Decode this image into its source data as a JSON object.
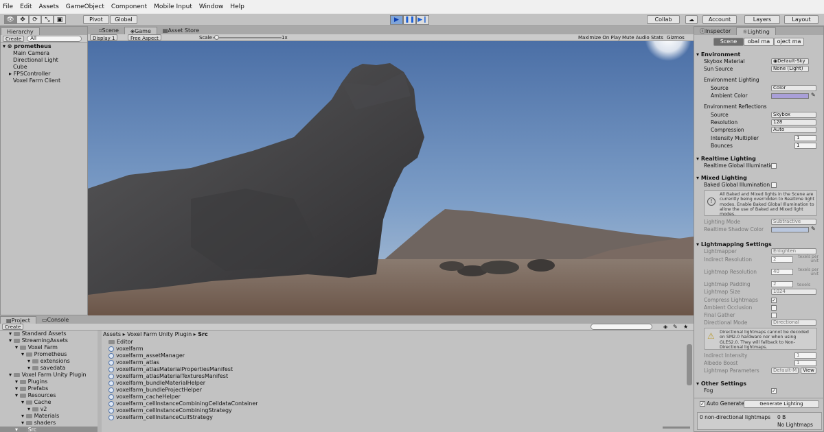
{
  "menu": [
    "File",
    "Edit",
    "Assets",
    "GameObject",
    "Component",
    "Mobile Input",
    "Window",
    "Help"
  ],
  "toolbar": {
    "pivot": "Pivot",
    "global": "Global",
    "collab": "Collab",
    "account": "Account",
    "layers": "Layers",
    "layout": "Layout"
  },
  "hierarchy": {
    "tab": "Hierarchy",
    "create": "Create",
    "search": "All",
    "scene": "prometheus",
    "items": [
      "Main Camera",
      "Directional Light",
      "Cube",
      "FPSController",
      "Voxel Farm Client"
    ]
  },
  "views": {
    "tabs": [
      "Scene",
      "Game",
      "Asset Store"
    ],
    "display": "Display 1",
    "aspect": "Free Aspect",
    "scale_label": "Scale",
    "scale_value": "1x",
    "buttons": [
      "Maximize On Play",
      "Mute Audio",
      "Stats",
      "Gizmos"
    ]
  },
  "inspector": {
    "tabs": [
      "Inspector",
      "Lighting"
    ],
    "seg": [
      "Scene",
      "obal ma",
      "oject ma"
    ],
    "environment": {
      "title": "Environment",
      "skybox_label": "Skybox Material",
      "skybox_val": "Default-Sky",
      "sun_label": "Sun Source",
      "sun_val": "None (Light)",
      "env_lighting": "Environment Lighting",
      "source_label": "Source",
      "source_val": "Color",
      "ambient_label": "Ambient Color",
      "ambient_color": "#a99fd8",
      "reflections": "Environment Reflections",
      "rsource_val": "Skybox",
      "resolution_label": "Resolution",
      "resolution_val": "128",
      "compression_label": "Compression",
      "compression_val": "Auto",
      "intensity_label": "Intensity Multiplier",
      "intensity_val": "1",
      "bounces_label": "Bounces",
      "bounces_val": "1"
    },
    "realtime": {
      "title": "Realtime Lighting",
      "gi_label": "Realtime Global Illuminatic"
    },
    "mixed": {
      "title": "Mixed Lighting",
      "baked_label": "Baked Global Illumination",
      "info": "All Baked and Mixed lights in the Scene are currently being overridden to Realtime light modes. Enable Baked Global Illumination to allow the use of Baked and Mixed light modes.",
      "mode_label": "Lighting Mode",
      "mode_val": "Subtractive",
      "shadow_label": "Realtime Shadow Color",
      "shadow_color": "#b9c6dd"
    },
    "lightmapping": {
      "title": "Lightmapping Settings",
      "lightmapper_label": "Lightmapper",
      "lightmapper_val": "Enlighten",
      "indirect_label": "Indirect Resolution",
      "indirect_val": "2",
      "indirect_unit": "texels per unit",
      "lmres_label": "Lightmap Resolution",
      "lmres_val": "40",
      "lmres_unit": "texels per unit",
      "padding_label": "Lightmap Padding",
      "padding_val": "2",
      "padding_unit": "texels",
      "size_label": "Lightmap Size",
      "size_val": "1024",
      "compress_label": "Compress Lightmaps",
      "ao_label": "Ambient Occlusion",
      "fg_label": "Final Gather",
      "dir_label": "Directional Mode",
      "dir_val": "Directional",
      "dir_info": "Directional lightmaps cannot be decoded on SM2.0 hardware nor when using GLES2.0. They will fallback to Non-Directional lightmaps.",
      "ind_int_label": "Indirect Intensity",
      "ind_int_val": "1",
      "albedo_label": "Albedo Boost",
      "albedo_val": "1",
      "params_label": "Lightmap Parameters",
      "params_val": "Default-M",
      "params_btn": "View"
    },
    "other": {
      "title": "Other Settings",
      "fog_label": "Fog"
    },
    "auto_label": "Auto Generate",
    "generate_btn": "Generate Lighting",
    "status_left": "0 non-directional lightmaps",
    "status_size": "0 B",
    "status_none": "No Lightmaps"
  },
  "project": {
    "tabs": [
      "Project",
      "Console"
    ],
    "create": "Create",
    "tree": [
      {
        "t": "Standard Assets",
        "d": 1
      },
      {
        "t": "StreamingAssets",
        "d": 1
      },
      {
        "t": "Voxel Farm",
        "d": 2
      },
      {
        "t": "Prometheus",
        "d": 3
      },
      {
        "t": "extensions",
        "d": 4
      },
      {
        "t": "savedata",
        "d": 4
      },
      {
        "t": "Voxel Farm Unity Plugin",
        "d": 1
      },
      {
        "t": "Plugins",
        "d": 2
      },
      {
        "t": "Prefabs",
        "d": 2
      },
      {
        "t": "Resources",
        "d": 2
      },
      {
        "t": "Cache",
        "d": 3
      },
      {
        "t": "v2",
        "d": 4
      },
      {
        "t": "Materials",
        "d": 3
      },
      {
        "t": "shaders",
        "d": 3
      },
      {
        "t": "Src",
        "d": 2
      }
    ],
    "breadcrumb": [
      "Assets",
      "Voxel Farm Unity Plugin",
      "Src"
    ],
    "files": [
      "Editor",
      "voxelfarm",
      "voxelfarm_assetManager",
      "voxelfarm_atlas",
      "voxelfarm_atlasMaterialPropertiesManifest",
      "voxelfarm_atlasMaterialTexturesManifest",
      "voxelfarm_bundleMaterialHelper",
      "voxelfarm_bundleProjectHelper",
      "voxelfarm_cacheHelper",
      "voxelfarm_cellInstanceCombiningCelldataContainer",
      "voxelfarm_cellInstanceCombiningStrategy",
      "voxelfarm_cellInstanceCullStrategy"
    ]
  }
}
